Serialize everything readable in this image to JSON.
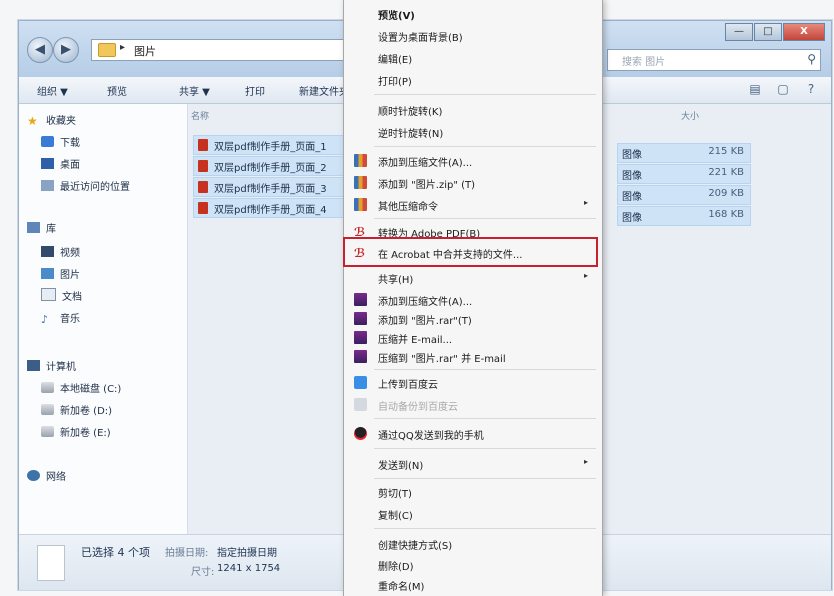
{
  "window": {
    "breadcrumb": "图片",
    "search_placeholder": "搜索 图片",
    "controls": [
      "—",
      "□",
      "X"
    ]
  },
  "toolbar": {
    "organize": "组织 ▼",
    "preview": "预览",
    "share": "共享 ▼",
    "print": "打印",
    "new_folder": "新建文件夹"
  },
  "nav": {
    "favorites": "收藏夹",
    "downloads": "下载",
    "desktop": "桌面",
    "recent": "最近访问的位置",
    "libraries": "库",
    "videos": "视频",
    "pictures": "图片",
    "documents": "文档",
    "music": "音乐",
    "computer": "计算机",
    "drive_c": "本地磁盘 (C:)",
    "drive_d": "新加卷 (D:)",
    "drive_e": "新加卷 (E:)",
    "network": "网络"
  },
  "columns": {
    "name": "名称",
    "size": "大小"
  },
  "files": [
    {
      "name": "双层pdf制作手册_页面_1",
      "type": "图像",
      "size": "215 KB"
    },
    {
      "name": "双层pdf制作手册_页面_2",
      "type": "图像",
      "size": "221 KB"
    },
    {
      "name": "双层pdf制作手册_页面_3",
      "type": "图像",
      "size": "209 KB"
    },
    {
      "name": "双层pdf制作手册_页面_4",
      "type": "图像",
      "size": "168 KB"
    }
  ],
  "details": {
    "selected": "已选择 4 个项",
    "date_key": "拍摄日期:",
    "date_value": "指定拍摄日期",
    "dims_key": "尺寸:",
    "dims_value": "1241 x 1754"
  },
  "menu": {
    "preview": "预览(V)",
    "set_wallpaper": "设置为桌面背景(B)",
    "edit": "编辑(E)",
    "print": "打印(P)",
    "rotate_cw": "顺时针旋转(K)",
    "rotate_ccw": "逆时针旋转(N)",
    "add_archive": "添加到压缩文件(A)...",
    "add_zip": "添加到 \"图片.zip\" (T)",
    "other_compress": "其他压缩命令",
    "convert_pdf": "转换为 Adobe PDF(B)",
    "acrobat_merge": "在 Acrobat 中合并支持的文件...",
    "share": "共享(H)",
    "rar_add_archive": "添加到压缩文件(A)...",
    "rar_add": "添加到 \"图片.rar\"(T)",
    "rar_email": "压缩并 E-mail...",
    "rar_email2": "压缩到 \"图片.rar\" 并 E-mail",
    "upload_cloud": "上传到百度云",
    "auto_backup": "自动备份到百度云",
    "qq_send": "通过QQ发送到我的手机",
    "send_to": "发送到(N)",
    "cut": "剪切(T)",
    "copy": "复制(C)",
    "shortcut": "创建快捷方式(S)",
    "delete": "删除(D)",
    "rename": "重命名(M)",
    "submenu_arrow": "▸"
  },
  "colors": {
    "highlight_border": "#c8202e",
    "selection": "#cfe3f7",
    "menu_bg": "#f6f6f6"
  },
  "icons": [
    "search-icon",
    "folder-icon",
    "star-icon",
    "pdf-icon",
    "acrobat-icon",
    "archive-icon",
    "winrar-icon",
    "cloud-icon",
    "qq-icon",
    "rotate-icon"
  ]
}
